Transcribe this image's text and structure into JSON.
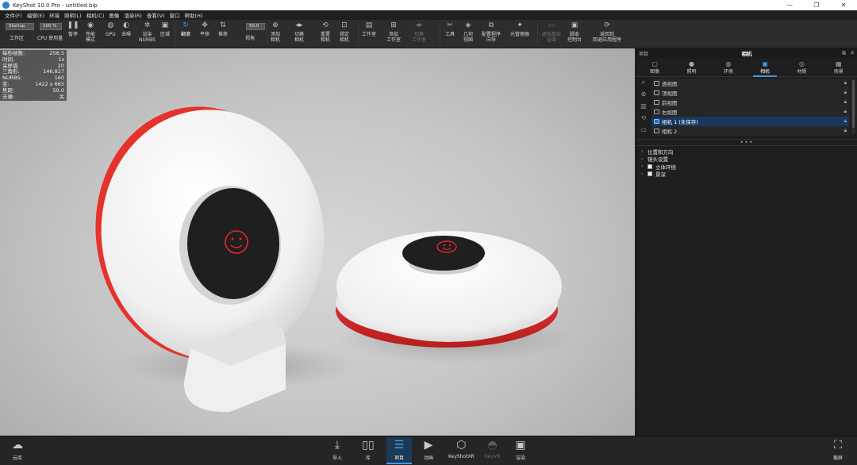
{
  "window": {
    "title": "KeyShot 10.0 Pro  - untitled.bip",
    "minimize": "—",
    "maximize": "❐",
    "close": "✕"
  },
  "menu": [
    "文件(F)",
    "编辑(E)",
    "环境",
    "照明(L)",
    "相机(C)",
    "图像",
    "渲染(R)",
    "查看(V)",
    "窗口",
    "帮助(H)"
  ],
  "toolbar": {
    "workspace_value": "Startup",
    "workspace_label": "工作区",
    "cpu_value": "100 %",
    "cpu_label": "CPU 使用量",
    "pause": "暂停",
    "perf_mode": "性能\n模式",
    "gpu": "GPU",
    "denoise": "去噪",
    "render_nurbs": "渲染\nNURBS",
    "region": "区域",
    "tumble": "翻滚",
    "pan": "平移",
    "dolly": "推移",
    "fov_value": "50.0",
    "fov_label": "视角",
    "add_camera": "添加\n相机",
    "switch_camera": "切换\n相机",
    "reset_camera": "重置\n相机",
    "lock_camera": "锁定\n相机",
    "studio": "工作室",
    "add_studio": "添加\n工作室",
    "switch_studio": "切换\n工作室",
    "tools": "工具",
    "geometry_view": "几何\n视图",
    "config_wizard": "配置程序\n向导",
    "light_manager": "光管理器",
    "vr_render": "虚拟现实\n渲染",
    "script_console": "脚本\n控制台",
    "return_app": "返回到\n回退应用程序"
  },
  "hud": [
    {
      "label": "每秒帧数:",
      "value": "256.5"
    },
    {
      "label": "时间:",
      "value": "1s"
    },
    {
      "label": "采样值",
      "value": "20"
    },
    {
      "label": "三角形:",
      "value": "146,827"
    },
    {
      "label": "NURBS:",
      "value": "160"
    },
    {
      "label": "变:",
      "value": "1422 x 665"
    },
    {
      "label": "焦距:",
      "value": "50.0"
    },
    {
      "label": "去噪:",
      "value": "关"
    }
  ],
  "panel": {
    "header_left": "项目",
    "header_title": "相机",
    "tabs": [
      "图像",
      "照明",
      "环境",
      "相机",
      "材质",
      "场景"
    ],
    "active_tab": "相机",
    "cameras": [
      "透视图",
      "顶视图",
      "前视图",
      "右视图",
      "相机 1 (未保存)",
      "相机 2"
    ],
    "selected_camera": "相机 1 (未保存)",
    "dots": "•••",
    "properties": [
      "位置和方向",
      "镜头设置"
    ],
    "sub_properties": [
      "立体环绕",
      "景深"
    ]
  },
  "dock": {
    "cloud": "云库",
    "import": "导入",
    "library": "库",
    "project": "项目",
    "animation": "动画",
    "keyshotxr": "KeyShotXR",
    "keyvr": "KeyVR",
    "render": "渲染",
    "screenshot": "截屏"
  },
  "colors": {
    "accent": "#3a98e8",
    "selection": "#17375e",
    "product_red": "#e8262a",
    "product_white": "#f4f4f4",
    "face_disc": "#1e1e1e"
  },
  "icons": [
    "search-icon",
    "camera-icon",
    "lock-icon",
    "tumble-icon",
    "pan-icon",
    "dolly-icon"
  ]
}
